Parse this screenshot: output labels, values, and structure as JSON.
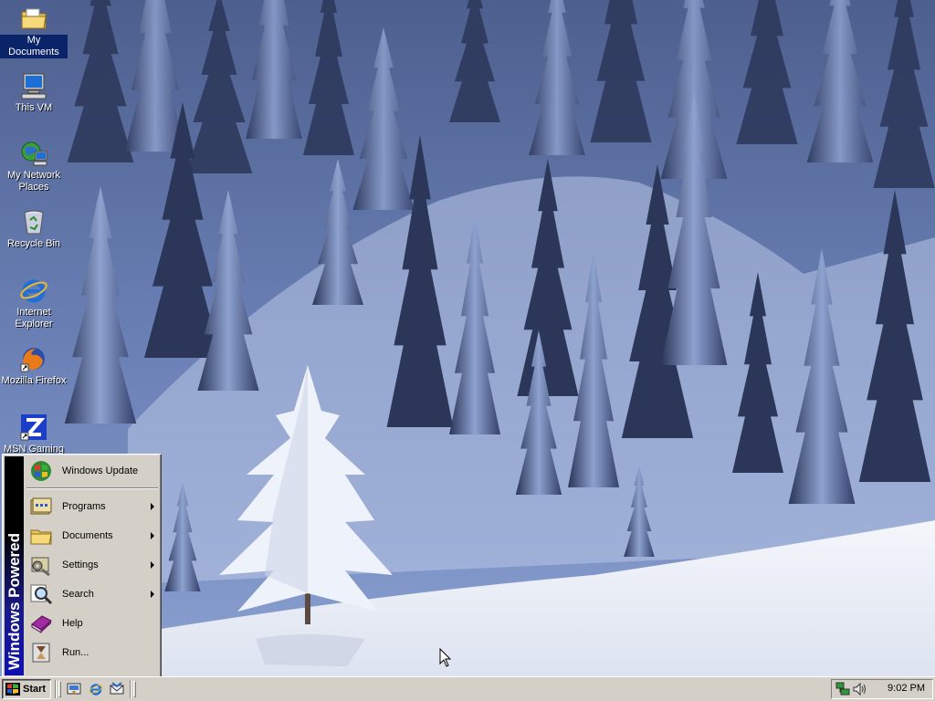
{
  "desktop": {
    "icons": [
      {
        "label": "My Documents",
        "icon": "folder-documents-icon"
      },
      {
        "label": "This VM",
        "icon": "computer-icon"
      },
      {
        "label": "My Network Places",
        "icon": "network-places-icon"
      },
      {
        "label": "Recycle Bin",
        "icon": "recycle-bin-icon"
      },
      {
        "label": "Internet Explorer",
        "icon": "internet-explorer-icon"
      },
      {
        "label": "Mozilla Firefox",
        "icon": "firefox-icon"
      },
      {
        "label": "MSN Gaming",
        "icon": "msn-gaming-icon"
      }
    ],
    "wallpaper": "snowy-forest"
  },
  "start_menu": {
    "banner": "Windows Powered",
    "items": [
      {
        "label": "Windows Update",
        "icon": "windows-update-icon",
        "submenu": false
      },
      {
        "label": "Programs",
        "icon": "programs-icon",
        "submenu": true
      },
      {
        "label": "Documents",
        "icon": "documents-folder-icon",
        "submenu": true
      },
      {
        "label": "Settings",
        "icon": "settings-icon",
        "submenu": true
      },
      {
        "label": "Search",
        "icon": "search-icon",
        "submenu": true
      },
      {
        "label": "Help",
        "icon": "help-book-icon",
        "submenu": false
      },
      {
        "label": "Run...",
        "icon": "run-icon",
        "submenu": false
      }
    ]
  },
  "taskbar": {
    "start_label": "Start",
    "quick_launch": [
      "show-desktop-icon",
      "internet-explorer-icon",
      "outlook-express-icon"
    ],
    "tray": {
      "icons": [
        "network-icon",
        "volume-icon"
      ],
      "clock": "9:02 PM"
    }
  },
  "colors": {
    "taskbar": "#d4d0c8",
    "selection": "#0a246a",
    "banner_top": "#000000",
    "banner_bottom": "#1010b0"
  }
}
